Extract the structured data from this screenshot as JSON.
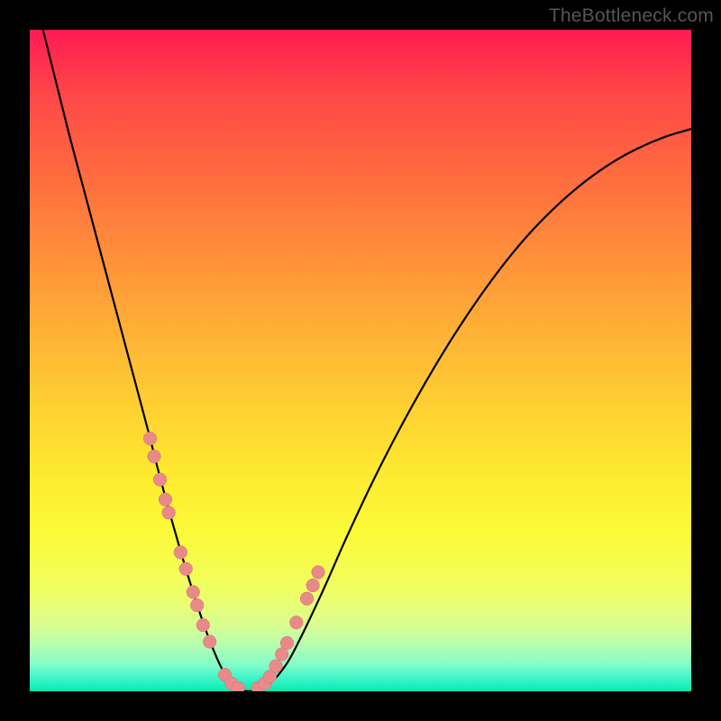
{
  "watermark": "TheBottleneck.com",
  "colors": {
    "curve": "#000000",
    "marker_fill": "#e98a8a",
    "marker_stroke": "#d86f6f",
    "frame": "#000000"
  },
  "chart_data": {
    "type": "line",
    "title": "",
    "xlabel": "",
    "ylabel": "",
    "xlim": [
      0,
      100
    ],
    "ylim": [
      0,
      100
    ],
    "curve": {
      "x": [
        0,
        2,
        4,
        6,
        8,
        10,
        12,
        14,
        16,
        18,
        19,
        20,
        21,
        22,
        23,
        24,
        25,
        26,
        27,
        28,
        29,
        30,
        31,
        32,
        34,
        36,
        38,
        40,
        44,
        48,
        52,
        56,
        60,
        64,
        68,
        72,
        76,
        80,
        84,
        88,
        92,
        96,
        100
      ],
      "y": [
        108,
        100,
        92,
        84,
        76.5,
        69,
        61.5,
        54,
        46.5,
        39,
        35,
        31.2,
        27.5,
        24,
        20.5,
        17.2,
        14,
        11,
        8.2,
        5.7,
        3.5,
        1.8,
        0.7,
        0.1,
        0.1,
        0.9,
        3,
        6.2,
        14.5,
        23.5,
        32,
        39.8,
        47,
        53.6,
        59.6,
        65,
        69.7,
        73.7,
        77.1,
        79.9,
        82.1,
        83.8,
        85
      ]
    },
    "series": [
      {
        "name": "left-branch-markers",
        "type": "scatter",
        "x": [
          18.2,
          18.8,
          19.7,
          20.5,
          21.0,
          22.8,
          23.6,
          24.7,
          25.3,
          26.2,
          27.2,
          29.5,
          30.5,
          31.5
        ],
        "y": [
          38.2,
          35.5,
          32.0,
          29.0,
          27.0,
          21.0,
          18.5,
          15.0,
          13.0,
          10.0,
          7.5,
          2.5,
          1.2,
          0.5
        ]
      },
      {
        "name": "right-branch-markers",
        "type": "scatter",
        "x": [
          34.5,
          35.5,
          36.3,
          37.2,
          38.1,
          38.9,
          40.3,
          41.9,
          42.8,
          43.6
        ],
        "y": [
          0.5,
          1.2,
          2.2,
          3.8,
          5.6,
          7.3,
          10.4,
          14.0,
          16.0,
          18.0
        ]
      }
    ],
    "marker_radius": 1.0
  }
}
